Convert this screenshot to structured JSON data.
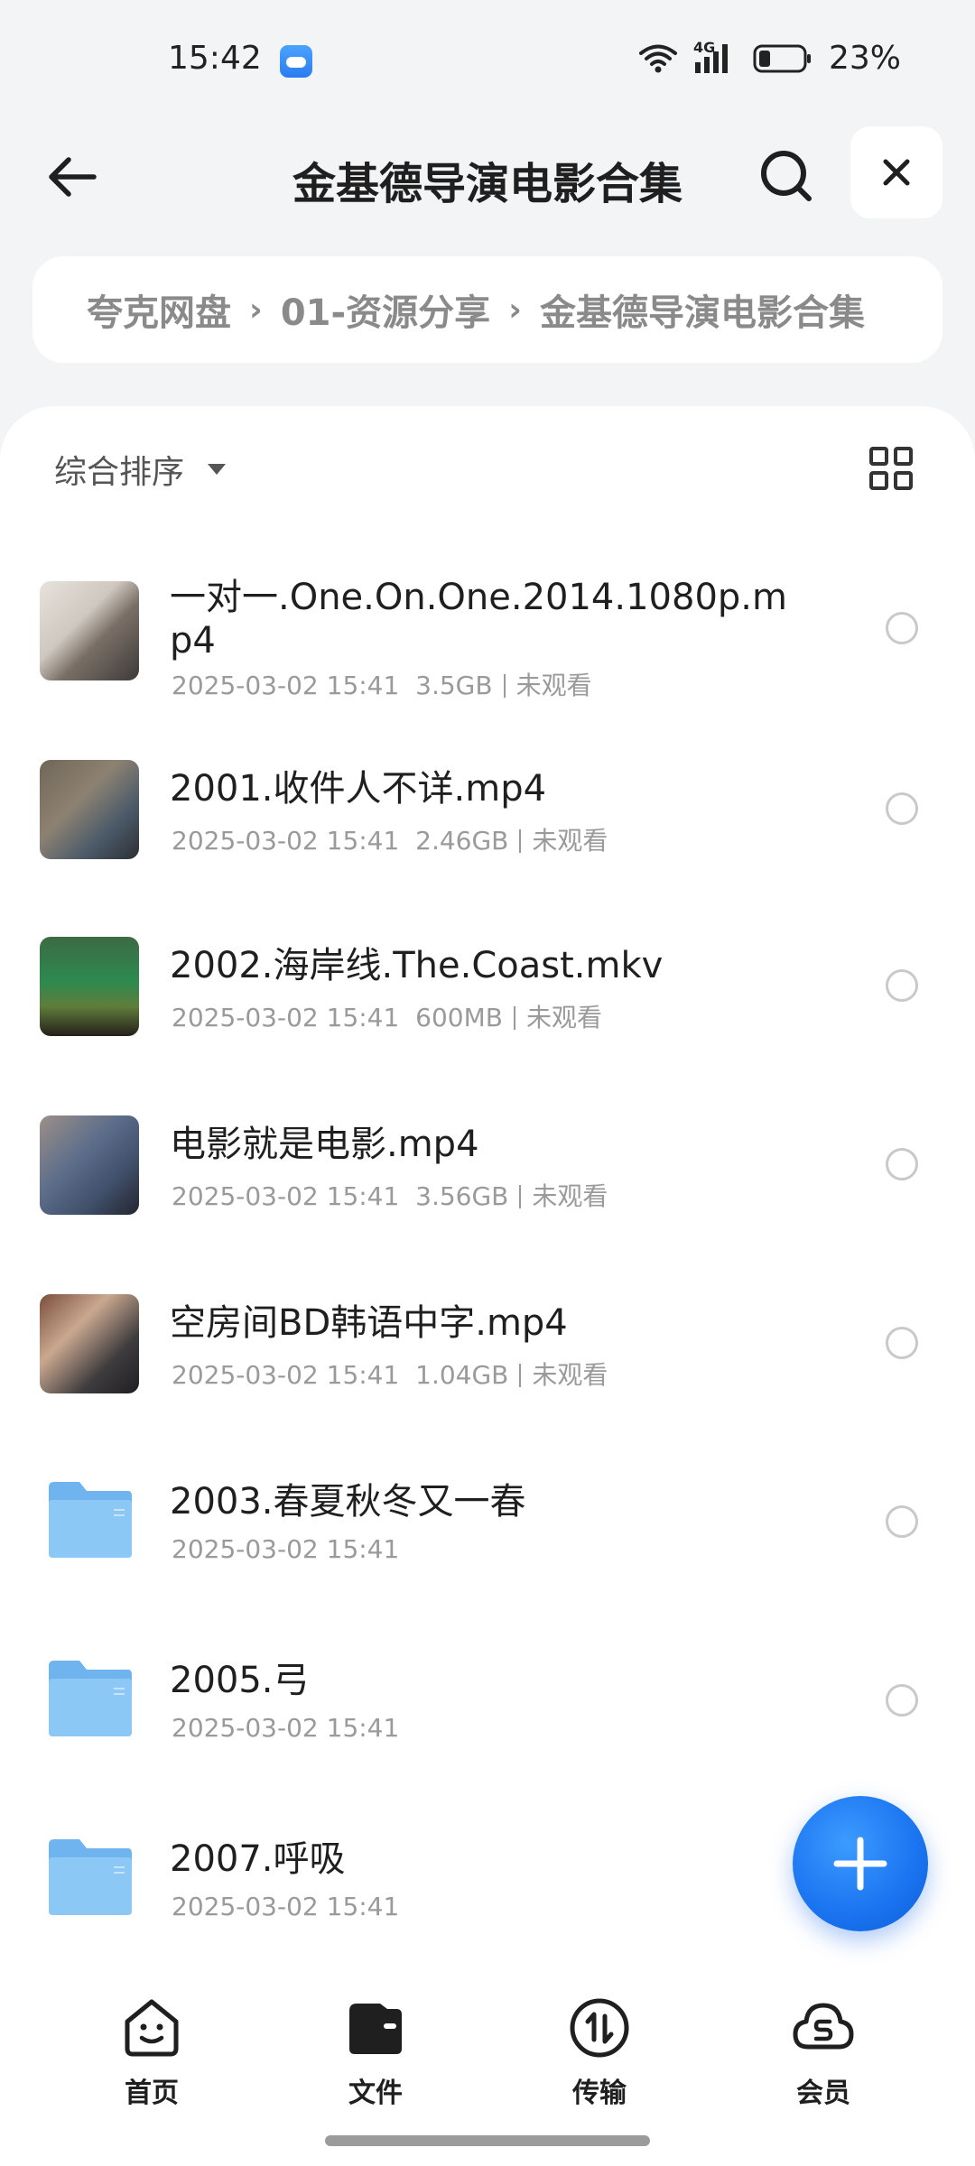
{
  "status_bar": {
    "time": "15:42",
    "battery_percent": "23%",
    "battery_level": 0.23,
    "network_label": "4G"
  },
  "header": {
    "title": "金基德导演电影合集"
  },
  "breadcrumb": {
    "items": [
      "夸克网盘",
      "01-资源分享",
      "金基德导演电影合集"
    ]
  },
  "toolbar": {
    "sort_label": "综合排序"
  },
  "files": [
    {
      "name": "一对一.One.On.One.2014.1080p.mp4",
      "date": "2025-03-02 15:41",
      "size": "3.5GB",
      "status": "未观看",
      "type": "video"
    },
    {
      "name": "2001.收件人不详.mp4",
      "date": "2025-03-02 15:41",
      "size": "2.46GB",
      "status": "未观看",
      "type": "video"
    },
    {
      "name": "2002.海岸线.The.Coast.mkv",
      "date": "2025-03-02 15:41",
      "size": "600MB",
      "status": "未观看",
      "type": "video"
    },
    {
      "name": "电影就是电影.mp4",
      "date": "2025-03-02 15:41",
      "size": "3.56GB",
      "status": "未观看",
      "type": "video"
    },
    {
      "name": "空房间BD韩语中字.mp4",
      "date": "2025-03-02 15:41",
      "size": "1.04GB",
      "status": "未观看",
      "type": "video"
    },
    {
      "name": "2003.春夏秋冬又一春",
      "date": "2025-03-02 15:41",
      "type": "folder"
    },
    {
      "name": "2005.弓",
      "date": "2025-03-02 15:41",
      "type": "folder"
    },
    {
      "name": "2007.呼吸",
      "date": "2025-03-02 15:41",
      "type": "folder"
    }
  ],
  "bottom_nav": {
    "items": [
      {
        "label": "首页",
        "icon": "home-smile-icon"
      },
      {
        "label": "文件",
        "icon": "wallet-folder-icon"
      },
      {
        "label": "传输",
        "icon": "transfer-icon"
      },
      {
        "label": "会员",
        "icon": "cloud-member-icon"
      }
    ],
    "active": "文件"
  },
  "colors": {
    "accent": "#1a73f0",
    "background": "#f3f4f6",
    "folder": "#8cc8f5"
  }
}
